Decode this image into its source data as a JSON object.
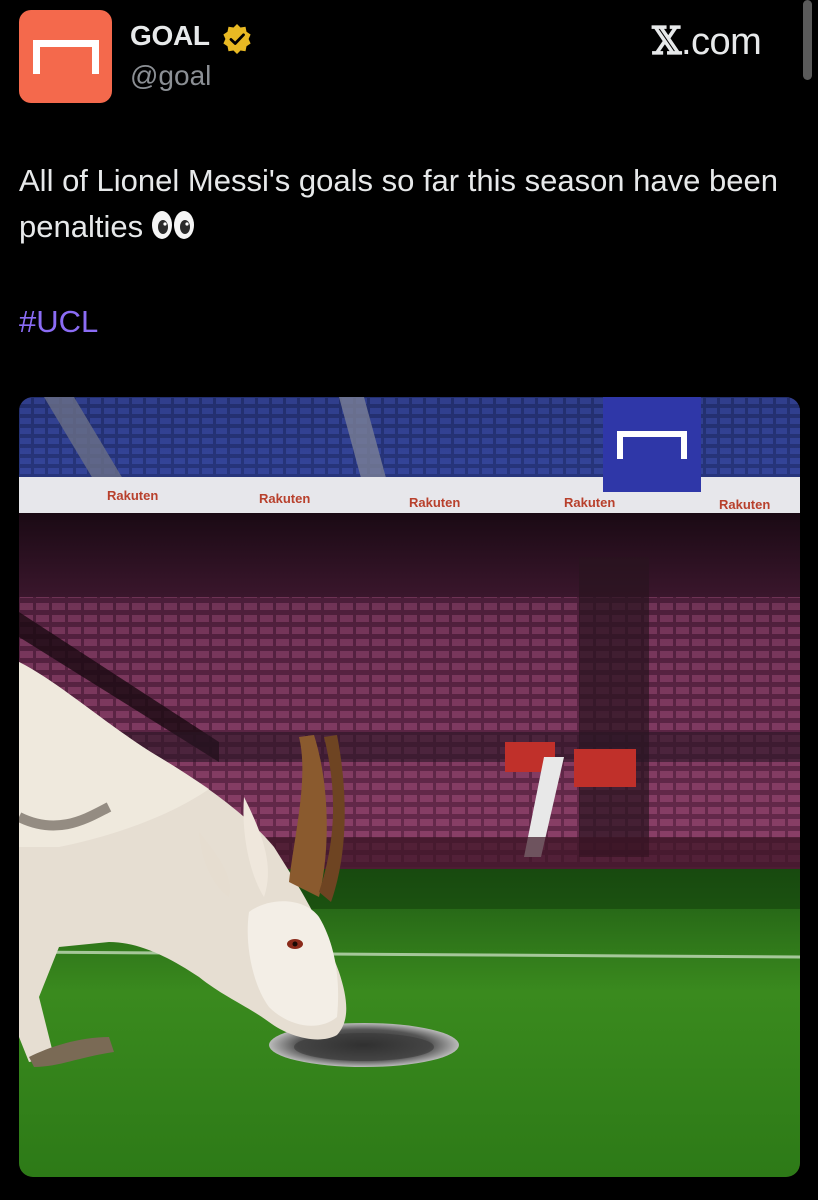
{
  "author": {
    "display_name": "GOAL",
    "handle": "@goal",
    "verified": true,
    "avatar_color": "#f4694c",
    "verified_badge_color": "#e8b923"
  },
  "site": {
    "logo_glyph": "𝕏",
    "logo_suffix": ".com"
  },
  "tweet": {
    "text": "All of Lionel Messi's goals so far this season have been penalties",
    "emoji": "eyes-emoji",
    "hashtag": "#UCL",
    "hashtag_color": "#8b6cf5"
  },
  "media": {
    "sponsor_boards": [
      "Rakuten",
      "Rakuten",
      "Rakuten",
      "Rakuten",
      "Rakuten"
    ],
    "corner_logo_color": "#2f37a8"
  }
}
